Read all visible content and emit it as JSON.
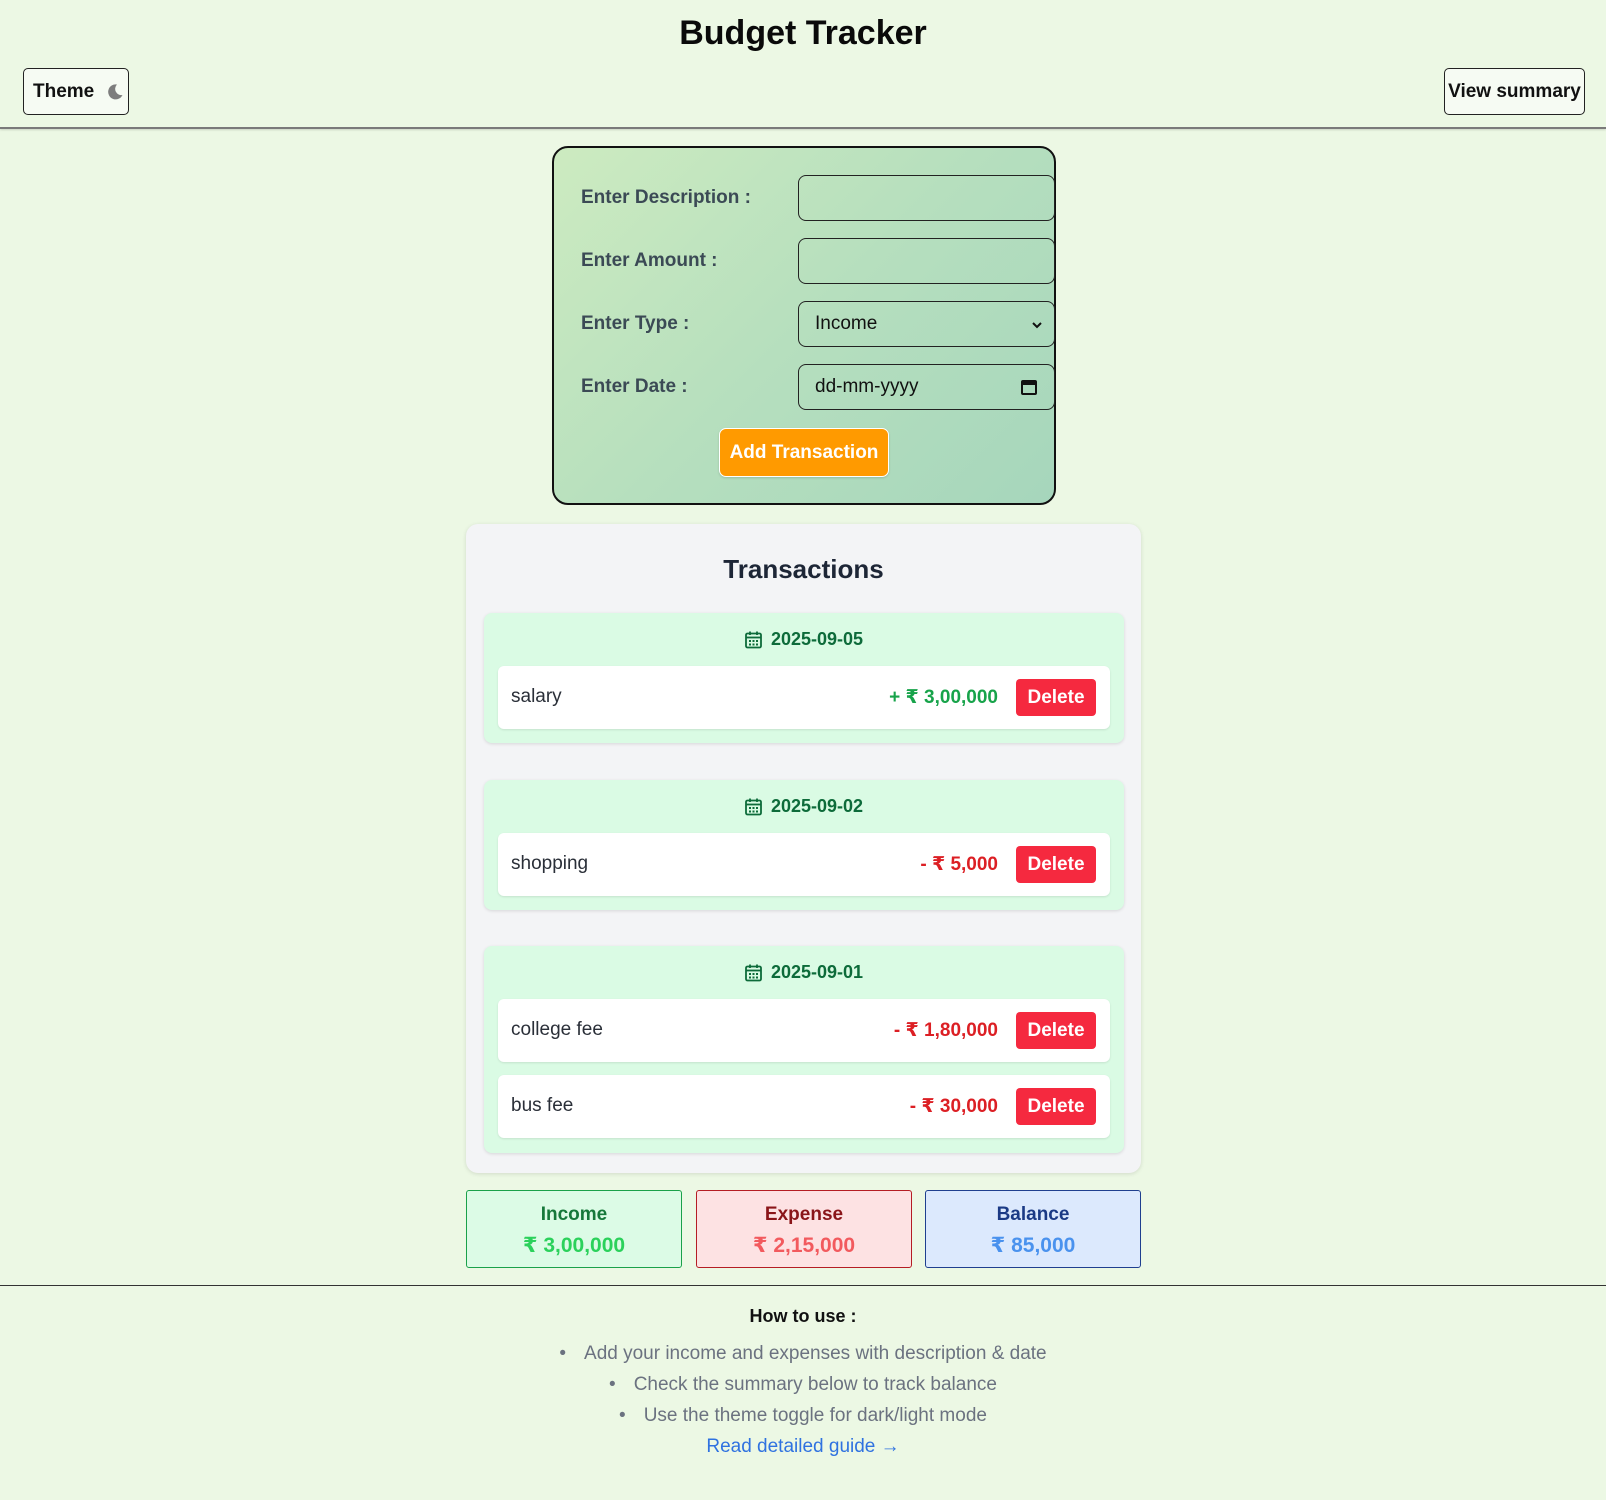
{
  "header": {
    "title": "Budget Tracker",
    "theme_label": "Theme",
    "summary_label": "View summary"
  },
  "form": {
    "description_label": "Enter Description :",
    "description_value": "",
    "amount_label": "Enter Amount :",
    "amount_value": "",
    "type_label": "Enter Type :",
    "type_value": "Income",
    "date_label": "Enter Date :",
    "date_placeholder": "dd-mm-yyyy",
    "add_label": "Add Transaction"
  },
  "transactions": {
    "title": "Transactions",
    "delete_label": "Delete",
    "groups": [
      {
        "date": "2025-09-05",
        "items": [
          {
            "description": "salary",
            "amount": "+ ₹ 3,00,000",
            "type": "income"
          }
        ]
      },
      {
        "date": "2025-09-02",
        "items": [
          {
            "description": "shopping",
            "amount": "- ₹ 5,000",
            "type": "expense"
          }
        ]
      },
      {
        "date": "2025-09-01",
        "items": [
          {
            "description": "college fee",
            "amount": "- ₹ 1,80,000",
            "type": "expense"
          },
          {
            "description": "bus fee",
            "amount": "- ₹ 30,000",
            "type": "expense"
          }
        ]
      }
    ]
  },
  "summary": {
    "income_label": "Income",
    "income_value": "₹ 3,00,000",
    "expense_label": "Expense",
    "expense_value": "₹ 2,15,000",
    "balance_label": "Balance",
    "balance_value": "₹ 85,000"
  },
  "footer": {
    "title": "How to use :",
    "steps": [
      "Add your income and expenses with description & date",
      "Check the summary below to track balance",
      "Use the theme toggle for dark/light mode"
    ],
    "guide_link": "Read detailed guide →"
  },
  "icons": {
    "theme": "moon-icon",
    "date": "calendar-icon",
    "select": "chevron-down-icon",
    "date_picker": "calendar-icon"
  },
  "colors": {
    "background": "#ecf8e4",
    "accent_button": "#ff9a00",
    "delete_button": "#f5293f",
    "income": "#17a34a",
    "expense": "#dc1f24",
    "balance": "#4a92ee"
  }
}
